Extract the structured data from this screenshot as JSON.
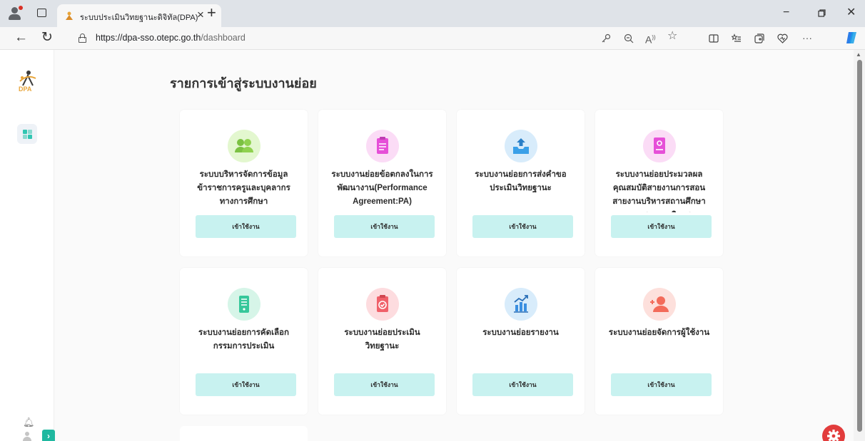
{
  "browser": {
    "tab_title": "ระบบประเมินวิทยฐานะดิจิทัล(DPA)",
    "url_host": "https://dpa-sso.otepc.go.th",
    "url_path": "/dashboard",
    "read_aloud": "A",
    "more": "···"
  },
  "sidebar": {
    "logo_text": "DPA"
  },
  "page": {
    "heading": "รายการเข้าสู่ระบบงานย่อย"
  },
  "cards": [
    {
      "title": "ระบบบริหารจัดการข้อมูลข้าราชการครูและบุคลากรทางการศึกษา",
      "button": "เข้าใช้งาน",
      "icon": "people-icon",
      "icon_color": "#8fd14f"
    },
    {
      "title": "ระบบงานย่อยข้อตกลงในการพัฒนางาน(Performance Agreement:PA)",
      "button": "เข้าใช้งาน",
      "icon": "clipboard-icon",
      "icon_color": "#e64fd8"
    },
    {
      "title": "ระบบงานย่อยการส่งคำขอประเมินวิทยฐานะ",
      "button": "เข้าใช้งาน",
      "icon": "upload-tray-icon",
      "icon_color": "#3aa0e8"
    },
    {
      "title": "ระบบงานย่อยประมวลผลคุณสมบัติสายงานการสอน สายงานบริหารสถานศึกษา และสายงานนิเทศ",
      "button": "เข้าใช้งาน",
      "icon": "id-document-icon",
      "icon_color": "#e64fd8"
    },
    {
      "title": "ระบบงานย่อยการคัดเลือกกรรมการประเมิน",
      "button": "เข้าใช้งาน",
      "icon": "document-icon",
      "icon_color": "#36c79a"
    },
    {
      "title": "ระบบงานย่อยประเมินวิทยฐานะ",
      "button": "เข้าใช้งาน",
      "icon": "clipboard-check-icon",
      "icon_color": "#f0606a"
    },
    {
      "title": "ระบบงานย่อยรายงาน",
      "button": "เข้าใช้งาน",
      "icon": "bar-chart-icon",
      "icon_color": "#3a8fe0"
    },
    {
      "title": "ระบบงานย่อยจัดการผู้ใช้งาน",
      "button": "เข้าใช้งาน",
      "icon": "add-user-icon",
      "icon_color": "#f36b5a"
    }
  ]
}
